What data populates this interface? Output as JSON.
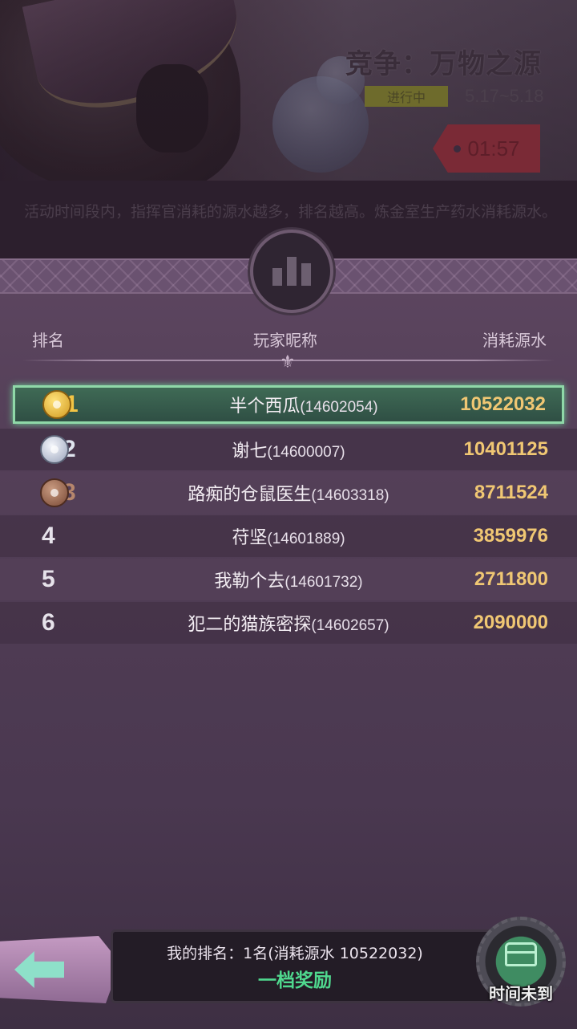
{
  "event": {
    "title": "竞争：万物之源",
    "status": "进行中",
    "date_range": "5.17~5.18",
    "countdown": "01:57",
    "description": "活动时间段内，指挥官消耗的源水越多，排名越高。炼金室生产药水消耗源水。"
  },
  "table": {
    "headers": {
      "rank": "排名",
      "name": "玩家昵称",
      "value": "消耗源水"
    },
    "rows": [
      {
        "rank": "1",
        "medal": "gold",
        "name": "半个西瓜",
        "uid": "(14602054)",
        "value": "10522032"
      },
      {
        "rank": "2",
        "medal": "silver",
        "name": "谢七",
        "uid": "(14600007)",
        "value": "10401125"
      },
      {
        "rank": "3",
        "medal": "bronze",
        "name": "路痴的仓鼠医生",
        "uid": "(14603318)",
        "value": "8711524"
      },
      {
        "rank": "4",
        "medal": "",
        "name": "苻坚",
        "uid": "(14601889)",
        "value": "3859976"
      },
      {
        "rank": "5",
        "medal": "",
        "name": "我勒个去",
        "uid": "(14601732)",
        "value": "2711800"
      },
      {
        "rank": "6",
        "medal": "",
        "name": "犯二的猫族密探",
        "uid": "(14602657)",
        "value": "2090000"
      }
    ]
  },
  "footer": {
    "my_rank": "我的排名：1名(消耗源水 10522032)",
    "reward_tier": "一档奖励",
    "reward_button_label": "时间未到"
  },
  "icons": {
    "back": "back-arrow-icon",
    "chart": "bar-chart-icon",
    "reward": "treasure-chest-icon"
  },
  "colors": {
    "highlight_border": "#8fd8a8",
    "value_text": "#f0c773",
    "reward_text": "#4fd88e",
    "timer_tag": "#7a2a36"
  }
}
